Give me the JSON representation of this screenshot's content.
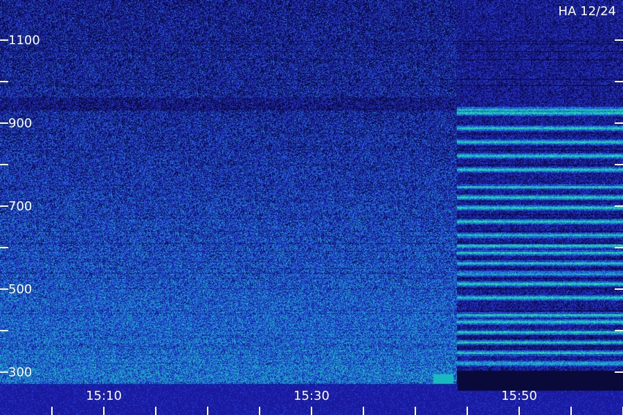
{
  "chart_data": {
    "type": "heatmap",
    "title": "",
    "corner_label": "HA 12/24",
    "xlabel": "",
    "ylabel": "",
    "x_tick_labels": [
      "15:10",
      "15:30",
      "15:50"
    ],
    "y_tick_labels": [
      "1100",
      "900",
      "700",
      "500",
      "300"
    ],
    "y_tick_values": [
      1100,
      900,
      700,
      500,
      300
    ],
    "y_minor_tick_values": [
      1100,
      1000,
      900,
      800,
      700,
      600,
      500,
      400,
      300
    ],
    "colormap": [
      "#0a0a3a",
      "#1a1aa0",
      "#2540d8",
      "#1d7ad6",
      "#18b8c0",
      "#22e0a0",
      "#40ff70"
    ],
    "colors": {
      "background": "#0a0a3a",
      "axis": "#ffffff",
      "gap": "#000000"
    }
  }
}
